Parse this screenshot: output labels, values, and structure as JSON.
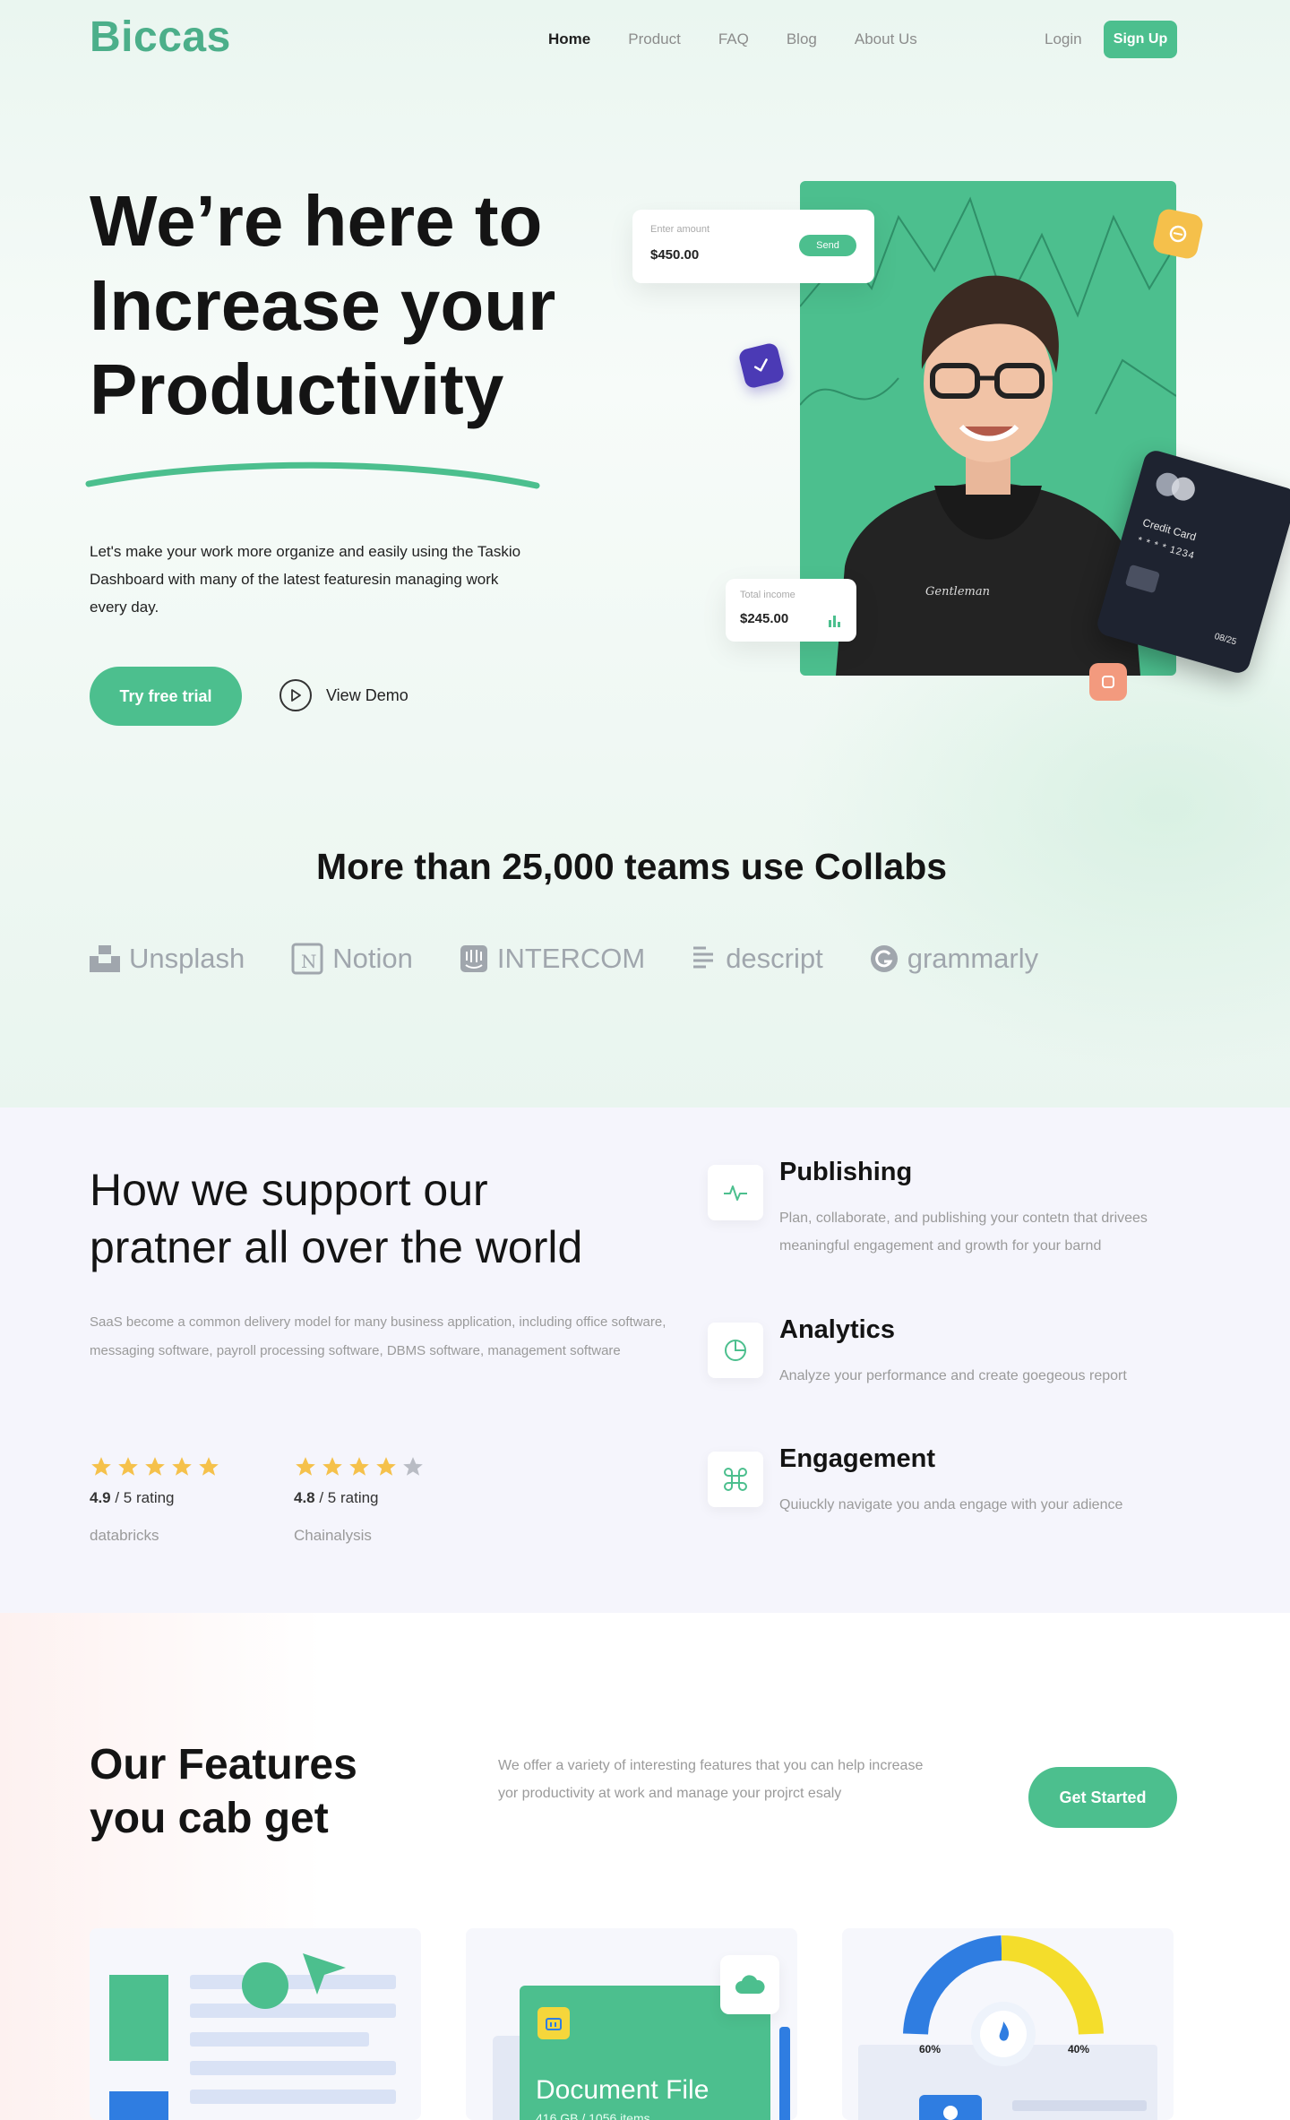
{
  "nav": {
    "logo": "Biccas",
    "links": [
      "Home",
      "Product",
      "FAQ",
      "Blog",
      "About Us"
    ],
    "login": "Login",
    "signup": "Sign Up"
  },
  "hero": {
    "title_lines": [
      "We’re here to",
      "Increase your",
      "Productivity"
    ],
    "description": "Let's make your work more organize and easily using the Taskio Dashboard with many of the latest featuresin managing work every day.",
    "cta_trial": "Try free trial",
    "cta_demo": "View Demo",
    "amount_card": {
      "label": "Enter amount",
      "value": "$450.00",
      "button": "Send"
    },
    "income_card": {
      "label": "Total income",
      "value": "$245.00"
    },
    "credit_card": {
      "name": "Credit Card",
      "number": "* * * *  1234",
      "expiry": "08/25"
    }
  },
  "teams": {
    "title": "More than 25,000 teams use Collabs",
    "brands": [
      {
        "name": "Unsplash",
        "icon": "unsplash-icon"
      },
      {
        "name": "Notion",
        "icon": "notion-icon"
      },
      {
        "name": "INTERCOM",
        "icon": "intercom-icon"
      },
      {
        "name": "descript",
        "icon": "descript-icon"
      },
      {
        "name": "grammarly",
        "icon": "grammarly-icon"
      }
    ]
  },
  "support": {
    "title_lines": [
      "How we support our",
      "pratner all over the world"
    ],
    "description": "SaaS become a common delivery model for many business application, including office software, messaging software, payroll processing software, DBMS software, management software",
    "ratings": [
      {
        "stars": 5,
        "value": "4.9",
        "scale": " / 5 rating",
        "source": "databricks"
      },
      {
        "stars": 4,
        "value": "4.8",
        "scale": " / 5 rating",
        "source": "Chainalysis"
      }
    ],
    "features": [
      {
        "title": "Publishing",
        "description": "Plan, collaborate, and publishing your contetn that drivees meaningful engagement and growth for your barnd",
        "icon": "pulse-icon"
      },
      {
        "title": "Analytics",
        "description": "Analyze your performance and create goegeous report",
        "icon": "pie-chart-icon"
      },
      {
        "title": "Engagement",
        "description": "Quiuckly navigate you anda engage with your adience",
        "icon": "command-icon"
      }
    ]
  },
  "features": {
    "title_lines": [
      "Our Features",
      "you cab get"
    ],
    "description": "We offer a variety of interesting features that you can help increase yor productivity at work and manage your projrct esaly",
    "cta": "Get Started",
    "document_card": {
      "title": "Document File",
      "meta": "416 GB / 1056 items"
    },
    "gauge": {
      "left_value": "60%",
      "right_value": "40%"
    }
  },
  "colors": {
    "brand_green": "#4cbf8e",
    "star_yellow": "#f5c14b",
    "support_bg": "#f5f5fc",
    "dark_text": "#141414",
    "muted_text": "#9a9a9a"
  }
}
